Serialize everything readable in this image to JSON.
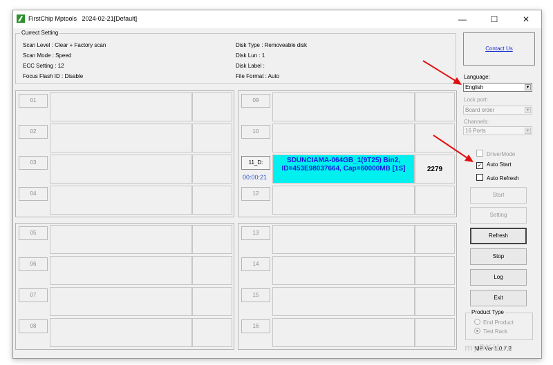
{
  "window": {
    "title": "FirstChip Mptools",
    "date_config": "2024-02-21[Default]",
    "minimize": "—",
    "maximize": "☐",
    "close": "✕"
  },
  "current_setting": {
    "title": "Currect Setting",
    "scan_level": "Scan Level : Clear + Factory scan",
    "scan_mode": "Scan Mode : Speed",
    "ecc": "ECC Setting : 12",
    "focus_flash": "Focus Flash ID : Disable",
    "disk_type": "Disk Type : Removeable disk",
    "disk_lun": "Disk Lun : 1",
    "disk_label": "Disk Label :",
    "file_format": "File Format : Auto"
  },
  "ports": {
    "p01": "01",
    "p02": "02",
    "p03": "03",
    "p04": "04",
    "p05": "05",
    "p06": "06",
    "p07": "07",
    "p08": "08",
    "p09": "09",
    "p10": "10",
    "p11": "11_D:",
    "p12": "12",
    "p13": "13",
    "p14": "14",
    "p15": "15",
    "p16": "16",
    "p11_timer": "00:00:21",
    "p11_info": "SDUNCIAMA-064GB_1(9T25) Bin2, ID=453E98037664, Cap=60000MB [1S]",
    "p11_count": "2279"
  },
  "sidebar": {
    "contact": "Contact Us",
    "language_label": "Language:",
    "language_value": "English",
    "lockport_label": "Lock port:",
    "lockport_value": "Board order",
    "channels_label": "Channels:",
    "channels_value": "16 Ports",
    "drivermode": "DriverMode",
    "autostart": "Auto Start",
    "autorefresh": "Auto Refresh",
    "start": "Start",
    "setting": "Setting",
    "refresh": "Refresh",
    "stop": "Stop",
    "log": "Log",
    "exit": "Exit",
    "product_type": "Product Type",
    "end_product": "End Product",
    "test_rack": "Test Rack",
    "version": "MP Ver 1.0.7.2"
  },
  "watermark": "mySKU.ru",
  "colors": {
    "highlight_bg": "#00f0f0",
    "highlight_text": "#1a1ae0",
    "annotation_arrow": "#e01010",
    "link": "#1a2bd0"
  }
}
